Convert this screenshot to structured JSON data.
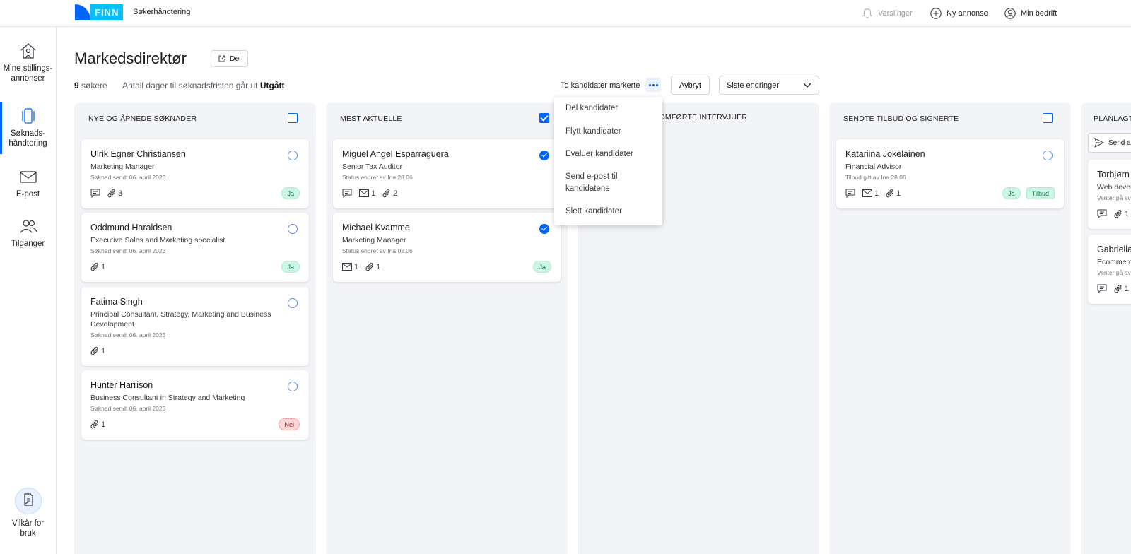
{
  "header": {
    "logo_text": "FINN",
    "app_name": "Søkerhåndtering",
    "notifications": "Varslinger",
    "new_ad": "Ny annonse",
    "my_company": "Min bedrift"
  },
  "sidebar": {
    "items": [
      {
        "label": "Mine stillings-annonser"
      },
      {
        "label": "Søknads-håndtering"
      },
      {
        "label": "E-post"
      },
      {
        "label": "Tilganger"
      }
    ],
    "footer_label": "Vilkår for bruk"
  },
  "page": {
    "title": "Markedsdirektør",
    "share_label": "Del",
    "applicant_count": "9",
    "applicant_suffix": "søkere",
    "deadline_text": "Antall dager til søknadsfristen går ut",
    "deadline_value": "Utgått",
    "selected_text": "To kandidater markerte",
    "cancel_label": "Avbryt",
    "sort_value": "Siste endringer"
  },
  "menu": {
    "items": [
      "Del kandidater",
      "Flytt kandidater",
      "Evaluer kandidater",
      "Send e-post til kandidatene",
      "Slett kandidater"
    ]
  },
  "columns": [
    {
      "title": "NYE OG ÅPNEDE SØKNADER",
      "cards": [
        {
          "name": "Ulrik Egner Christiansen",
          "role": "Marketing Manager",
          "meta": "Søknad sendt 06. april 2023",
          "comments": true,
          "attachments": "3",
          "badge": "Ja"
        },
        {
          "name": "Oddmund Haraldsen",
          "role": "Executive Sales and Marketing specialist",
          "meta": "Søknad sendt 06. april 2023",
          "attachments": "1",
          "badge": "Ja"
        },
        {
          "name": "Fatima Singh",
          "role": "Principal Consultant, Strategy, Marketing and Business Development",
          "meta": "Søknad sendt 06. april 2023",
          "attachments": "1"
        },
        {
          "name": "Hunter Harrison",
          "role": "Business Consultant in Strategy and Marketing",
          "meta": "Søknad sendt 06. april 2023",
          "attachments": "1",
          "badge": "Nei"
        }
      ]
    },
    {
      "title": "MEST AKTUELLE",
      "cards": [
        {
          "name": "Miguel Angel Esparraguera",
          "role": "Senior Tax Auditor",
          "meta": "Status endret av Ina 28.06",
          "mails": "1",
          "attachments": "2"
        },
        {
          "name": "Michael Kvamme",
          "role": "Marketing Manager",
          "meta": "Status endret av Ina 02.06",
          "mails": "1",
          "attachments": "1",
          "badge": "Ja"
        }
      ]
    },
    {
      "title": "GJENNOMFØRTE INTERVJUER",
      "title_visible": "NNOMFØRTE INTERVJUER",
      "cards": []
    },
    {
      "title": "SENDTE TILBUD OG SIGNERTE",
      "cards": [
        {
          "name": "Katariina Jokelainen",
          "role": "Financial Advisor",
          "meta": "Tilbud gitt av Ina 28.06",
          "mails": "1",
          "attachments": "1",
          "badge": "Ja",
          "badge2": "Tilbud"
        }
      ]
    },
    {
      "title_visible": "PLANLAGT",
      "send_label": "Send av",
      "cards": [
        {
          "name": "Torbjørn",
          "role": "Web devel",
          "meta": "Venter på av",
          "attachments": "1"
        },
        {
          "name": "Gabriella",
          "role": "Ecommerc",
          "meta": "Venter på av",
          "attachments": "1"
        }
      ]
    }
  ],
  "colors": {
    "brand_blue": "#0063fb",
    "brand_cyan": "#06bffc",
    "column_bg": "#f3f4f7",
    "badge_ja": "#ccf7e5",
    "badge_nei": "#fdd7d7"
  }
}
